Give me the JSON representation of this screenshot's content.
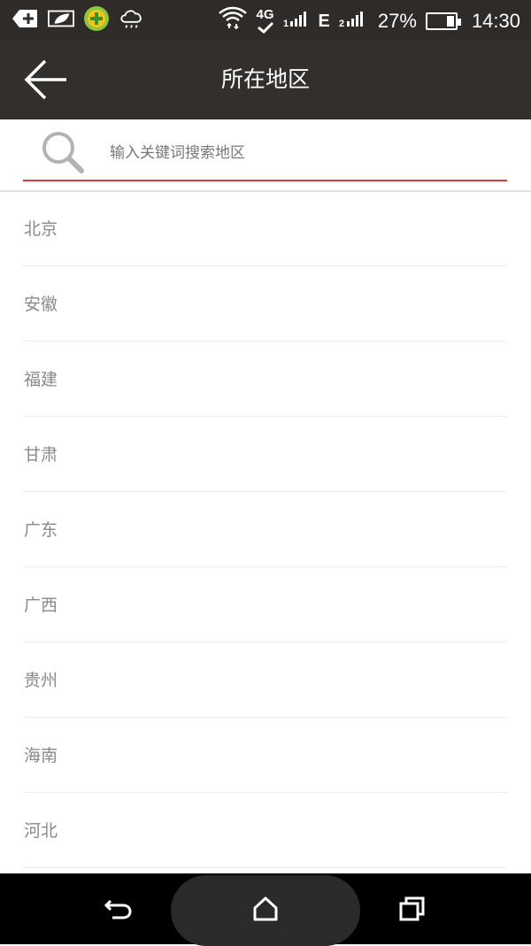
{
  "status_bar": {
    "network_type": "4G",
    "data_type": "E",
    "battery_percent": "27%",
    "battery_level": 0.27,
    "time": "14:30"
  },
  "header": {
    "title": "所在地区"
  },
  "search": {
    "placeholder": "输入关键词搜索地区",
    "value": ""
  },
  "regions": [
    "北京",
    "安徽",
    "福建",
    "甘肃",
    "广东",
    "广西",
    "贵州",
    "海南",
    "河北"
  ],
  "colors": {
    "app_bar": "#332f2d",
    "accent": "#d63a3a",
    "item_text": "#8a8a8a"
  }
}
